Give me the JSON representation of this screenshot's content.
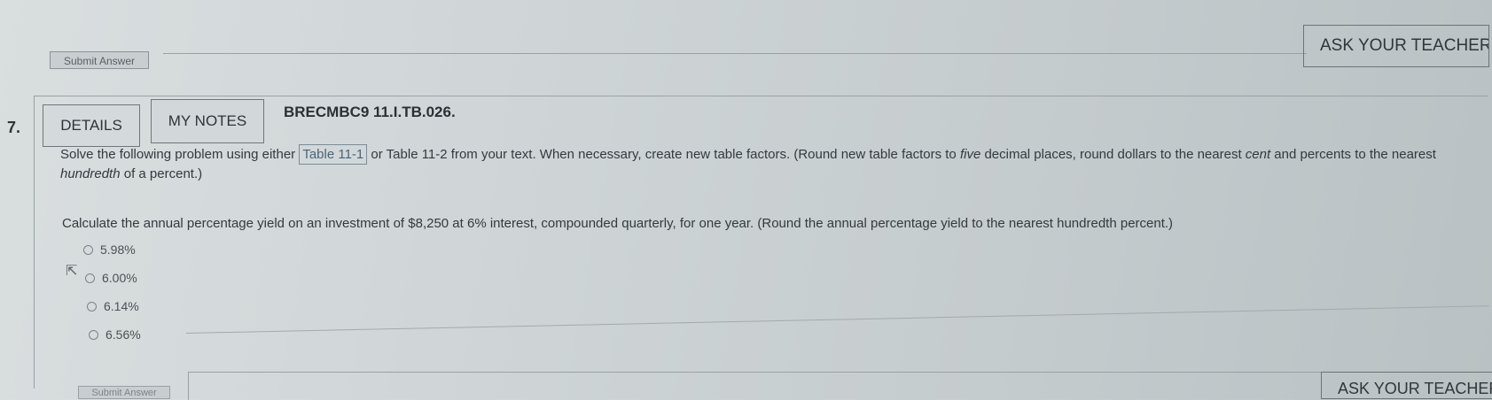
{
  "top_bar": {
    "submit_label": "Submit Answer",
    "ask_teacher_label": "ASK YOUR TEACHER"
  },
  "question": {
    "number": "7.",
    "details_label": "DETAILS",
    "my_notes_label": "MY NOTES",
    "problem_id": "BRECMBC9 11.I.TB.026.",
    "instructions_pre": "Solve the following problem using either ",
    "table_link_1": "Table 11-1",
    "instructions_mid": " or ",
    "table_link_2": "Table 11-2",
    "instructions_post_1": " from your text. When necessary, create new table factors. (Round new table factors to ",
    "instructions_em_1": "five",
    "instructions_post_2": " decimal places, round dollars to the nearest ",
    "instructions_em_2": "cent",
    "instructions_post_3": " and percents to the nearest ",
    "instructions_em_3": "hundredth",
    "instructions_post_4": " of a percent.)",
    "prompt": "Calculate the annual percentage yield on an investment of $8,250 at 6% interest, compounded quarterly, for one year. (Round the annual percentage yield to the nearest hundredth percent.)",
    "choices": [
      "5.98%",
      "6.00%",
      "6.14%",
      "6.56%"
    ]
  },
  "bottom_bar": {
    "submit_label": "Submit Answer",
    "ask_teacher_label": "ASK YOUR TEACHER"
  }
}
